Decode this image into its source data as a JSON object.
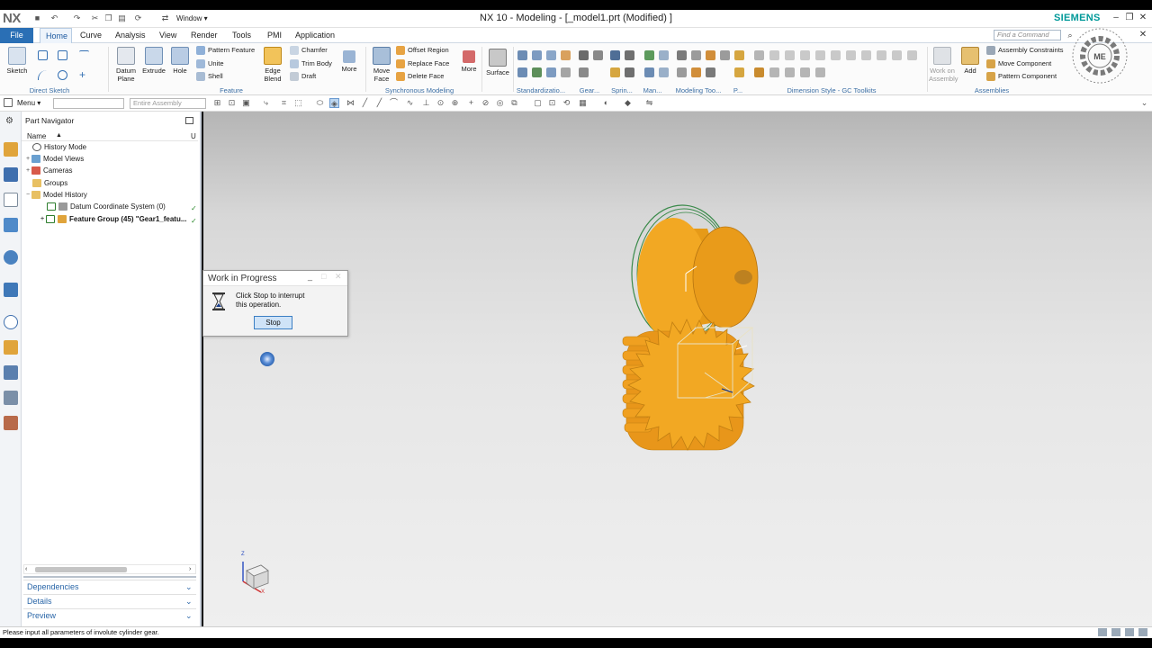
{
  "app": {
    "logo": "NX",
    "window_menu": "Window ▾",
    "title": "NX 10 - Modeling - [_model1.prt (Modified) ]",
    "brand": "SIEMENS"
  },
  "tabs": [
    "File",
    "Home",
    "Curve",
    "Analysis",
    "View",
    "Render",
    "Tools",
    "PMI",
    "Application"
  ],
  "search": {
    "placeholder": "Find a Command"
  },
  "ribbon": {
    "direct_sketch": {
      "label": "Direct Sketch",
      "sketch": "Sketch"
    },
    "feature": {
      "label": "Feature",
      "datum_plane": "Datum Plane",
      "extrude": "Extrude",
      "hole": "Hole",
      "pattern_feature": "Pattern Feature",
      "unite": "Unite",
      "shell": "Shell",
      "edge_blend": "Edge Blend",
      "chamfer": "Chamfer",
      "trim_body": "Trim Body",
      "draft": "Draft",
      "more": "More"
    },
    "sync": {
      "label": "Synchronous Modeling",
      "move_face": "Move Face",
      "offset_region": "Offset Region",
      "replace_face": "Replace Face",
      "delete_face": "Delete Face",
      "more": "More"
    },
    "surface": "Surface",
    "standardization": "Standardizatio...",
    "gear": "Gear...",
    "spring": "Sprin...",
    "man": "Man...",
    "modeling_tools": "Modeling Too...",
    "p": "P...",
    "dimension_style": "Dimension Style - GC Toolkits",
    "assemblies": {
      "label": "Assemblies",
      "work_on_assembly": "Work on Assembly",
      "add": "Add",
      "assembly_constraints": "Assembly Constraints",
      "move_component": "Move Component",
      "pattern_component": "Pattern Component"
    }
  },
  "cmdbar": {
    "menu": "Menu ▾",
    "filter": "",
    "scope": "Entire Assembly"
  },
  "navigator": {
    "title": "Part Navigator",
    "col_name": "Name",
    "col_u": "U",
    "rows": [
      {
        "label": "History Mode"
      },
      {
        "label": "Model Views"
      },
      {
        "label": "Cameras"
      },
      {
        "label": "Groups"
      },
      {
        "label": "Model History"
      },
      {
        "label": "Datum Coordinate System (0)"
      },
      {
        "label": "Feature Group (45) \"Gear1_featu..."
      }
    ],
    "panels": [
      "Dependencies",
      "Details",
      "Preview"
    ]
  },
  "dialog": {
    "title": "Work in Progress",
    "message_line1": "Click Stop to interrupt",
    "message_line2": "this operation.",
    "stop": "Stop"
  },
  "triad": {
    "x": "X",
    "z": "Z"
  },
  "status": "Please input all parameters of involute cylinder gear.",
  "watermark": "Department of Machine Tools · Szerszámgépek Tanszéke · ME",
  "colors": {
    "accent": "#2a6fb5",
    "gear": "#f0a020",
    "brand": "#009999"
  }
}
